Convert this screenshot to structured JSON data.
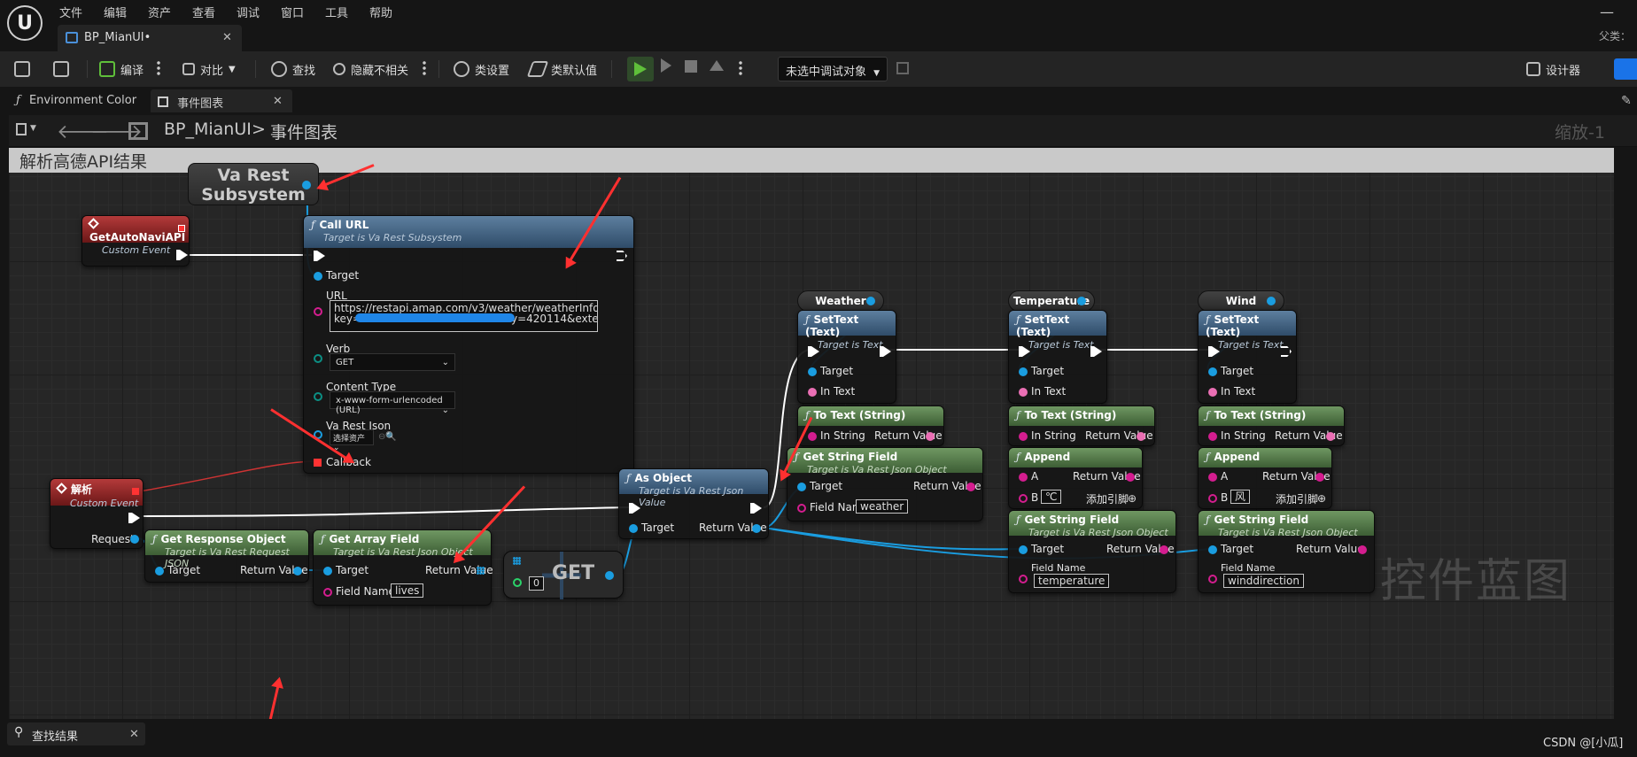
{
  "menubar": {
    "items": [
      "文件",
      "编辑",
      "资产",
      "查看",
      "调试",
      "窗口",
      "工具",
      "帮助"
    ],
    "doc_tab": "BP_MianUI•",
    "parent_label": "父类："
  },
  "toolbar": {
    "compile": "编译",
    "diff": "对比",
    "find": "查找",
    "hide_unrelated": "隐藏不相关",
    "class_settings": "类设置",
    "class_defaults": "类默认值",
    "debug_object": "未选中调试对象",
    "designer": "设计器"
  },
  "subtabs": {
    "env_color": "Environment Color",
    "event_graph": "事件图表"
  },
  "nav": {
    "blueprint": "BP_MianUI",
    "graph": "事件图表",
    "zoom": "缩放-1"
  },
  "graph": {
    "comment_title": "解析高德API结果",
    "va_rest": "Va Rest\nSubsystem",
    "ev_autonavi": {
      "title": "GetAutoNaviAPI",
      "subtitle": "Custom Event"
    },
    "call_url": {
      "title": "Call URL",
      "subtitle": "Target is Va Rest Subsystem",
      "target": "Target",
      "url_label": "URL",
      "url_value": "https://restapi.amap.com/v3/weather/weatherInfo?\nkey=                                    0&city=420114&extens",
      "verb_label": "Verb",
      "verb_value": "GET",
      "ct_label": "Content Type",
      "ct_value": "x-www-form-urlencoded (URL)",
      "json_label": "Va Rest Json",
      "json_value": "选择资产",
      "callback": "Callback"
    },
    "ev_parse": {
      "title": "解析",
      "subtitle": "Custom Event",
      "request": "Request"
    },
    "get_response": {
      "title": "Get Response Object",
      "subtitle": "Target is Va Rest Request JSON",
      "target": "Target",
      "ret": "Return Value"
    },
    "get_array": {
      "title": "Get Array Field",
      "subtitle": "Target is Va Rest Json Object",
      "target": "Target",
      "ret": "Return Value",
      "field_label": "Field Name",
      "field_value": "lives"
    },
    "get_node": {
      "title": "GET",
      "index": "0"
    },
    "as_object": {
      "title": "As Object",
      "subtitle": "Target is Va Rest Json Value",
      "target": "Target",
      "ret": "Return Value"
    },
    "weather": {
      "var": "Weather",
      "title": "SetText (Text)",
      "subtitle": "Target is Text",
      "target": "Target",
      "intext": "In Text",
      "totext": "To Text (String)",
      "instring": "In String",
      "ret": "Return Value"
    },
    "get_string_weather": {
      "title": "Get String Field",
      "subtitle": "Target is Va Rest Json Object",
      "target": "Target",
      "ret": "Return Value",
      "field_label": "Field Name",
      "field_value": "weather"
    },
    "temperature": {
      "var": "Temperature",
      "title": "SetText (Text)",
      "subtitle": "Target is Text",
      "target": "Target",
      "intext": "In Text",
      "totext": "To Text (String)",
      "instring": "In String",
      "ret": "Return Value",
      "append": "Append",
      "a": "A",
      "b": "B",
      "b_value": "℃",
      "add_pin": "添加引脚"
    },
    "get_string_temp": {
      "title": "Get String Field",
      "subtitle": "Target is Va Rest Json Object",
      "target": "Target",
      "ret": "Return Value",
      "field_label": "Field Name",
      "field_value": "temperature"
    },
    "wind": {
      "var": "Wind",
      "title": "SetText (Text)",
      "subtitle": "Target is Text",
      "target": "Target",
      "intext": "In Text",
      "totext": "To Text (String)",
      "instring": "In String",
      "ret": "Return Value",
      "append": "Append",
      "a": "A",
      "b": "B",
      "b_value": "风",
      "add_pin": "添加引脚"
    },
    "get_string_wind": {
      "title": "Get String Field",
      "subtitle": "Target is Va Rest Json Object",
      "target": "Target",
      "ret": "Return Value",
      "field_label": "Field Name",
      "field_value": "winddirection"
    },
    "watermark": "控件蓝图"
  },
  "bottom": {
    "find_results": "查找结果",
    "credit": "CSDN @[小瓜]"
  },
  "colors": {
    "exec": "#ffffff",
    "object": "#1a9de0",
    "string": "#d41d8f",
    "text": "#ea6fb4",
    "arrow": "#ff3030"
  }
}
